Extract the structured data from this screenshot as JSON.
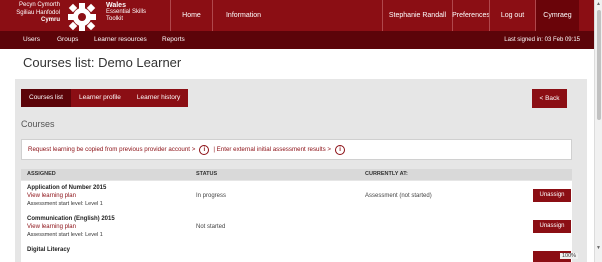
{
  "header": {
    "logo_left": [
      "Pecyn Cymorth",
      "Sgiliau Hanfodol",
      "Cymru"
    ],
    "logo_right": [
      "Wales",
      "Essential Skills",
      "Toolkit"
    ],
    "nav": [
      "Home",
      "Information",
      "Stephanie Randall",
      "Preferences",
      "Log out",
      "Cymraeg"
    ],
    "icons": {
      "logo": "gear-logo-icon"
    }
  },
  "subnav": {
    "items": [
      "Users",
      "Groups",
      "Learner resources",
      "Reports"
    ],
    "last_signed": "Last signed in: 03 Feb 09:15"
  },
  "page": {
    "title": "Courses list: Demo Learner"
  },
  "tabs": [
    "Courses list",
    "Learner profile",
    "Learner history"
  ],
  "back_label": "< Back",
  "section_title": "Courses",
  "links": {
    "copy": "Request learning be copied from previous provider account >",
    "sep": "| Enter external initial assessment results >",
    "info_icon": "i"
  },
  "table": {
    "headers": [
      "ASSIGNED",
      "STATUS",
      "CURRENTLY AT:"
    ],
    "rows": [
      {
        "name": "Application of Number 2015",
        "plan": "View learning plan",
        "level": "Assessment start level: Level 1",
        "status": "In progress",
        "current": "Assessment (not started)",
        "action": "Unassign"
      },
      {
        "name": "Communication (English) 2015",
        "plan": "View learning plan",
        "level": "Assessment start level: Level 1",
        "status": "Not started",
        "current": "",
        "action": "Unassign"
      },
      {
        "name": "Digital Literacy",
        "plan": "",
        "level": "",
        "status": "",
        "current": "",
        "action": ""
      }
    ]
  },
  "zoom": "100%",
  "colors": {
    "brand": "#8b0e14",
    "brand_dark": "#5c0409"
  }
}
